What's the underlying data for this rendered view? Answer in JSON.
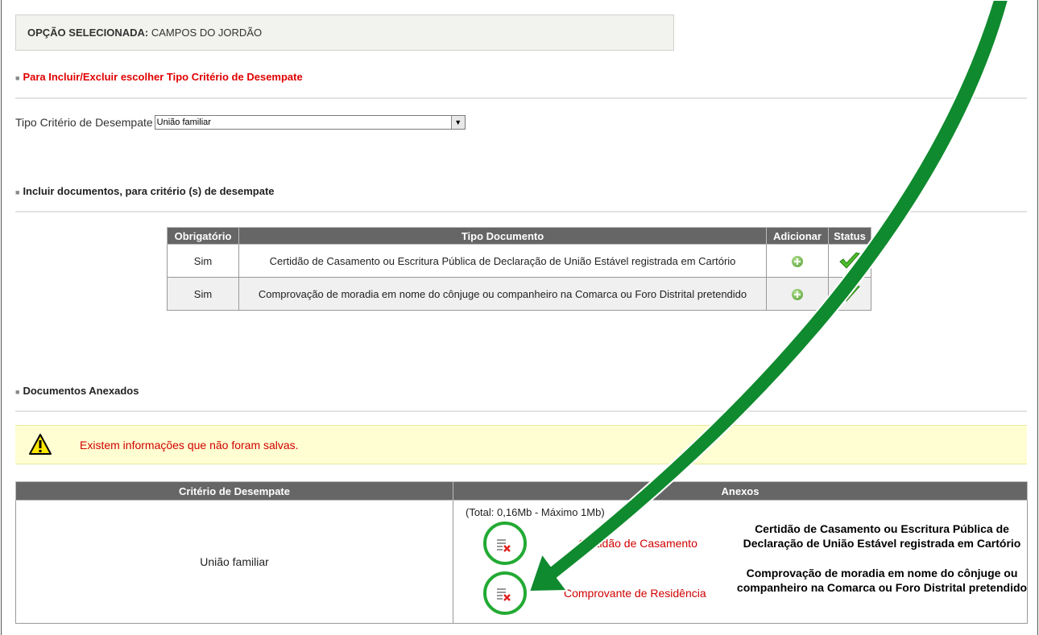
{
  "option": {
    "label": "OPÇÃO SELECIONADA:",
    "value": "CAMPOS DO JORDÃO"
  },
  "section_include_exclude": "Para Incluir/Excluir escolher Tipo Critério de Desempate",
  "tipo_criterio": {
    "label": "Tipo Critério de Desempate",
    "selected": "União familiar"
  },
  "section_include_docs": "Incluir documentos, para critério (s) de desempate",
  "docs_table": {
    "headers": [
      "Obrigatório",
      "Tipo Documento",
      "Adicionar",
      "Status"
    ],
    "rows": [
      {
        "obrigatorio": "Sim",
        "tipo": "Certidão de Casamento ou Escritura Pública de Declaração de União Estável registrada em Cartório"
      },
      {
        "obrigatorio": "Sim",
        "tipo": "Comprovação de moradia em nome do cônjuge ou companheiro na Comarca ou Foro Distrital pretendido"
      }
    ]
  },
  "section_attached": "Documentos Anexados",
  "warning": "Existem informações que não foram salvas.",
  "anexos_table": {
    "headers": [
      "Critério de Desempate",
      "Anexos"
    ],
    "criterio": "União familiar",
    "total": "(Total: 0,16Mb - Máximo 1Mb)",
    "files": [
      {
        "link": "Certidão de Casamento",
        "description": "Certidão de Casamento ou Escritura Pública de Declaração de União Estável registrada em Cartório"
      },
      {
        "link": "Comprovante de Residência",
        "description": "Comprovação de moradia em nome do cônjuge ou companheiro na Comarca ou Foro Distrital pretendido"
      }
    ]
  },
  "colors": {
    "accent_red": "#e00000",
    "header_gray": "#666666",
    "annotation_green": "#0f8a2e"
  }
}
